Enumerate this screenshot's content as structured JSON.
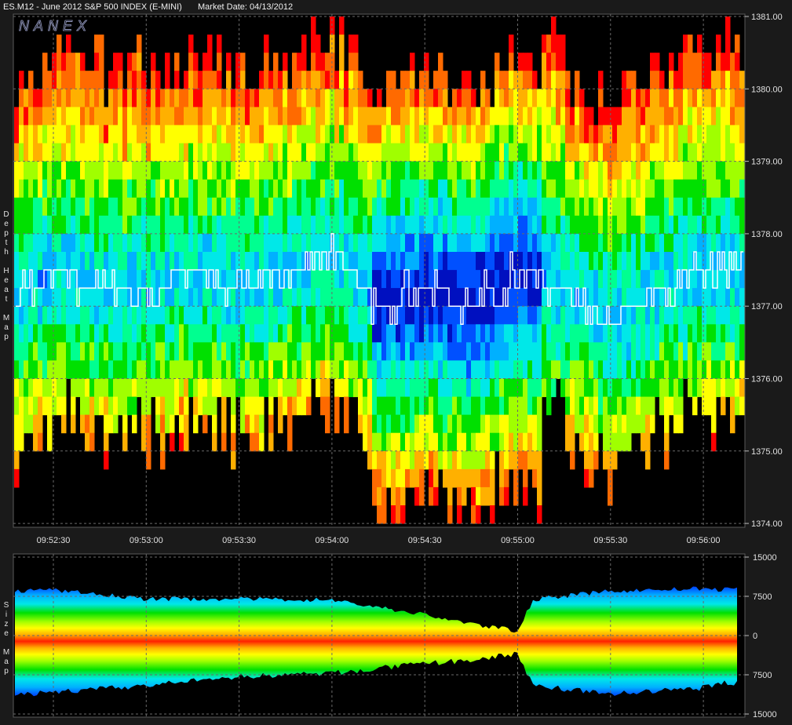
{
  "header": {
    "symbol_title": "ES.M12 - June 2012 S&P 500 INDEX (E-MINI)",
    "market_date": "Market Date: 04/13/2012"
  },
  "watermark": "NANEX",
  "side_labels": {
    "heat": [
      "D",
      "e",
      "p",
      "t",
      "h",
      " ",
      "H",
      "e",
      "a",
      "t",
      " ",
      "M",
      "a",
      "p"
    ],
    "size": [
      "S",
      "i",
      "z",
      "e",
      " ",
      "M",
      "a",
      "p"
    ]
  },
  "colors": {
    "background": "#000000",
    "panel_border": "#5a5a5a",
    "grid": "#6a6a6a",
    "price_line": "#ffffff",
    "heat_scale": [
      "#ff0000",
      "#ff6a00",
      "#ffb000",
      "#ffff00",
      "#a0ff00",
      "#00e000",
      "#00ff90",
      "#00e8e8",
      "#00b0ff",
      "#0050ff",
      "#0010c0"
    ]
  },
  "chart_data": [
    {
      "type": "heatmap",
      "name": "Depth Heat Map",
      "x_ticks": [
        "09:52:30",
        "09:53:00",
        "09:53:30",
        "09:54:00",
        "09:54:30",
        "09:55:00",
        "09:55:30",
        "09:56:00"
      ],
      "y_ticks": [
        "1381.00",
        "1380.00",
        "1379.00",
        "1378.00",
        "1377.00",
        "1376.00",
        "1375.00",
        "1374.00"
      ],
      "ylim": [
        1374.0,
        1381.0
      ],
      "y_tick_values": [
        1381.0,
        1380.0,
        1379.0,
        1378.0,
        1377.0,
        1376.0,
        1375.0,
        1374.0
      ],
      "price_step": 0.25,
      "price_series": {
        "times": [
          "09:52:15",
          "09:52:30",
          "09:52:45",
          "09:53:00",
          "09:53:15",
          "09:53:30",
          "09:53:45",
          "09:54:00",
          "09:54:15",
          "09:54:30",
          "09:54:45",
          "09:55:00",
          "09:55:15",
          "09:55:30",
          "09:55:45",
          "09:56:00",
          "09:56:05"
        ],
        "prices": [
          1377.0,
          1377.5,
          1377.25,
          1377.25,
          1377.5,
          1377.25,
          1377.5,
          1377.75,
          1377.0,
          1377.25,
          1377.0,
          1377.5,
          1377.25,
          1376.75,
          1377.25,
          1377.5,
          1377.5
        ]
      }
    },
    {
      "type": "area",
      "name": "Size Map",
      "x_ticks": [
        "09:52:30",
        "09:53:00",
        "09:53:30",
        "09:54:00",
        "09:54:30",
        "09:55:00",
        "09:55:30",
        "09:56:00"
      ],
      "y_ticks": [
        "15000",
        "7500",
        "0",
        "7500",
        "15000"
      ],
      "y_tick_values": [
        15000,
        7500,
        0,
        -7500,
        -15000
      ],
      "ylim": [
        -15000,
        15000
      ],
      "envelope_upper": {
        "times": [
          "09:52:15",
          "09:52:30",
          "09:53:00",
          "09:53:30",
          "09:54:00",
          "09:54:30",
          "09:54:45",
          "09:55:00",
          "09:55:05",
          "09:55:30",
          "09:56:00",
          "09:56:05"
        ],
        "values": [
          8500,
          8700,
          7000,
          7000,
          6800,
          4000,
          2200,
          900,
          6900,
          8500,
          9000,
          8800
        ]
      },
      "envelope_lower": {
        "times": [
          "09:52:15",
          "09:52:30",
          "09:53:00",
          "09:53:30",
          "09:54:00",
          "09:54:30",
          "09:54:45",
          "09:55:00",
          "09:55:05",
          "09:55:30",
          "09:56:00",
          "09:56:05"
        ],
        "values": [
          -11500,
          -10800,
          -9600,
          -7800,
          -7200,
          -5400,
          -4700,
          -3500,
          -9500,
          -11200,
          -10000,
          -9000
        ]
      }
    }
  ]
}
